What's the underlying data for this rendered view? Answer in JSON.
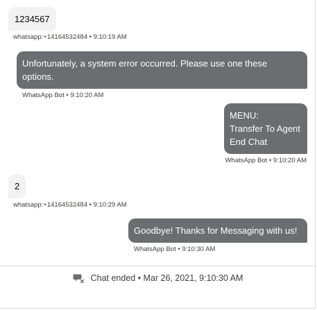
{
  "messages": [
    {
      "sender": "customer",
      "text": "1234567",
      "meta": "whatsapp:+14164532484 • 9:10:19 AM"
    },
    {
      "sender": "bot",
      "text_lines": [
        "Unfortunately, a system error occurred. Please use one these",
        "options."
      ],
      "meta": "WhatsApp Bot • 9:10:20 AM"
    },
    {
      "sender": "bot",
      "text_lines": [
        "MENU:",
        "Transfer To Agent",
        "End Chat"
      ],
      "meta": "WhatsApp Bot • 9:10:20 AM"
    },
    {
      "sender": "customer",
      "text": "2",
      "meta": "whatsapp:+14164532484 • 9:10:29 AM"
    },
    {
      "sender": "bot",
      "text": "Goodbye! Thanks for Messaging with us!",
      "meta": "WhatsApp Bot • 9:10:30 AM"
    }
  ],
  "chat_ended": {
    "icon": "chat-ended-icon",
    "text": "Chat ended • Mar 26, 2021, 9:10:30 AM"
  },
  "colors": {
    "inbound_bubble": "#f3f2f2",
    "outbound_bubble": "#6b6d70",
    "meta_text": "#3e3e3c"
  }
}
